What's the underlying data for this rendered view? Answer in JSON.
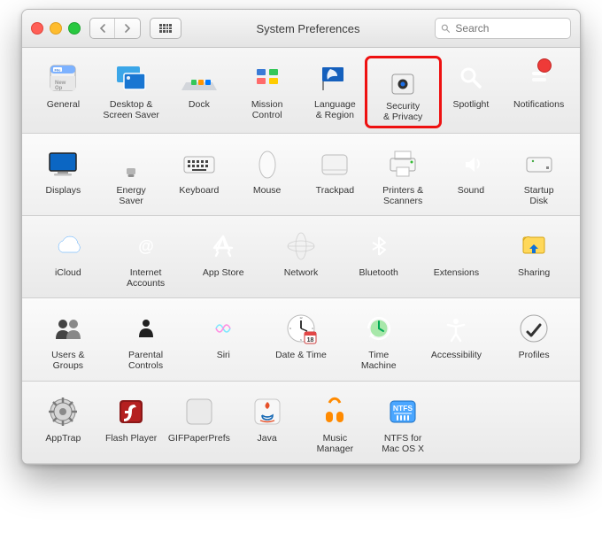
{
  "window": {
    "title": "System Preferences"
  },
  "search": {
    "placeholder": "Search"
  },
  "highlight_key": "security",
  "rows": [
    {
      "cols": 8,
      "light": false,
      "items": [
        {
          "key": "general",
          "label": "General",
          "icon": "general-icon"
        },
        {
          "key": "desktop",
          "label": "Desktop &\nScreen Saver",
          "icon": "desktop-icon"
        },
        {
          "key": "dock",
          "label": "Dock",
          "icon": "dock-icon"
        },
        {
          "key": "mission",
          "label": "Mission\nControl",
          "icon": "mission-control-icon"
        },
        {
          "key": "language",
          "label": "Language\n& Region",
          "icon": "language-region-icon"
        },
        {
          "key": "security",
          "label": "Security\n& Privacy",
          "icon": "security-privacy-icon"
        },
        {
          "key": "spotlight",
          "label": "Spotlight",
          "icon": "spotlight-icon"
        },
        {
          "key": "notifications",
          "label": "Notifications",
          "icon": "notifications-icon",
          "badge": true
        }
      ]
    },
    {
      "cols": 8,
      "light": true,
      "items": [
        {
          "key": "displays",
          "label": "Displays",
          "icon": "displays-icon"
        },
        {
          "key": "energy",
          "label": "Energy\nSaver",
          "icon": "energy-saver-icon"
        },
        {
          "key": "keyboard",
          "label": "Keyboard",
          "icon": "keyboard-icon"
        },
        {
          "key": "mouse",
          "label": "Mouse",
          "icon": "mouse-icon"
        },
        {
          "key": "trackpad",
          "label": "Trackpad",
          "icon": "trackpad-icon"
        },
        {
          "key": "printers",
          "label": "Printers &\nScanners",
          "icon": "printers-scanners-icon"
        },
        {
          "key": "sound",
          "label": "Sound",
          "icon": "sound-icon"
        },
        {
          "key": "startup",
          "label": "Startup\nDisk",
          "icon": "startup-disk-icon"
        }
      ]
    },
    {
      "cols": 7,
      "light": false,
      "items": [
        {
          "key": "icloud",
          "label": "iCloud",
          "icon": "icloud-icon"
        },
        {
          "key": "internet",
          "label": "Internet\nAccounts",
          "icon": "internet-accounts-icon"
        },
        {
          "key": "appstore",
          "label": "App Store",
          "icon": "app-store-icon"
        },
        {
          "key": "network",
          "label": "Network",
          "icon": "network-icon"
        },
        {
          "key": "bluetooth",
          "label": "Bluetooth",
          "icon": "bluetooth-icon"
        },
        {
          "key": "extensions",
          "label": "Extensions",
          "icon": "extensions-icon"
        },
        {
          "key": "sharing",
          "label": "Sharing",
          "icon": "sharing-icon"
        }
      ]
    },
    {
      "cols": 7,
      "light": true,
      "items": [
        {
          "key": "users",
          "label": "Users &\nGroups",
          "icon": "users-groups-icon"
        },
        {
          "key": "parental",
          "label": "Parental\nControls",
          "icon": "parental-controls-icon"
        },
        {
          "key": "siri",
          "label": "Siri",
          "icon": "siri-icon"
        },
        {
          "key": "datetime",
          "label": "Date & Time",
          "icon": "date-time-icon"
        },
        {
          "key": "timemachine",
          "label": "Time\nMachine",
          "icon": "time-machine-icon"
        },
        {
          "key": "accessibility",
          "label": "Accessibility",
          "icon": "accessibility-icon"
        },
        {
          "key": "profiles",
          "label": "Profiles",
          "icon": "profiles-icon"
        }
      ]
    },
    {
      "cols": 8,
      "light": false,
      "items": [
        {
          "key": "apptrap",
          "label": "AppTrap",
          "icon": "apptrap-icon"
        },
        {
          "key": "flash",
          "label": "Flash Player",
          "icon": "flash-player-icon"
        },
        {
          "key": "gif",
          "label": "GIFPaperPrefs",
          "icon": "gifpaper-icon"
        },
        {
          "key": "java",
          "label": "Java",
          "icon": "java-icon"
        },
        {
          "key": "music",
          "label": "Music\nManager",
          "icon": "music-manager-icon"
        },
        {
          "key": "ntfs",
          "label": "NTFS for\nMac OS X",
          "icon": "ntfs-icon"
        }
      ]
    }
  ]
}
